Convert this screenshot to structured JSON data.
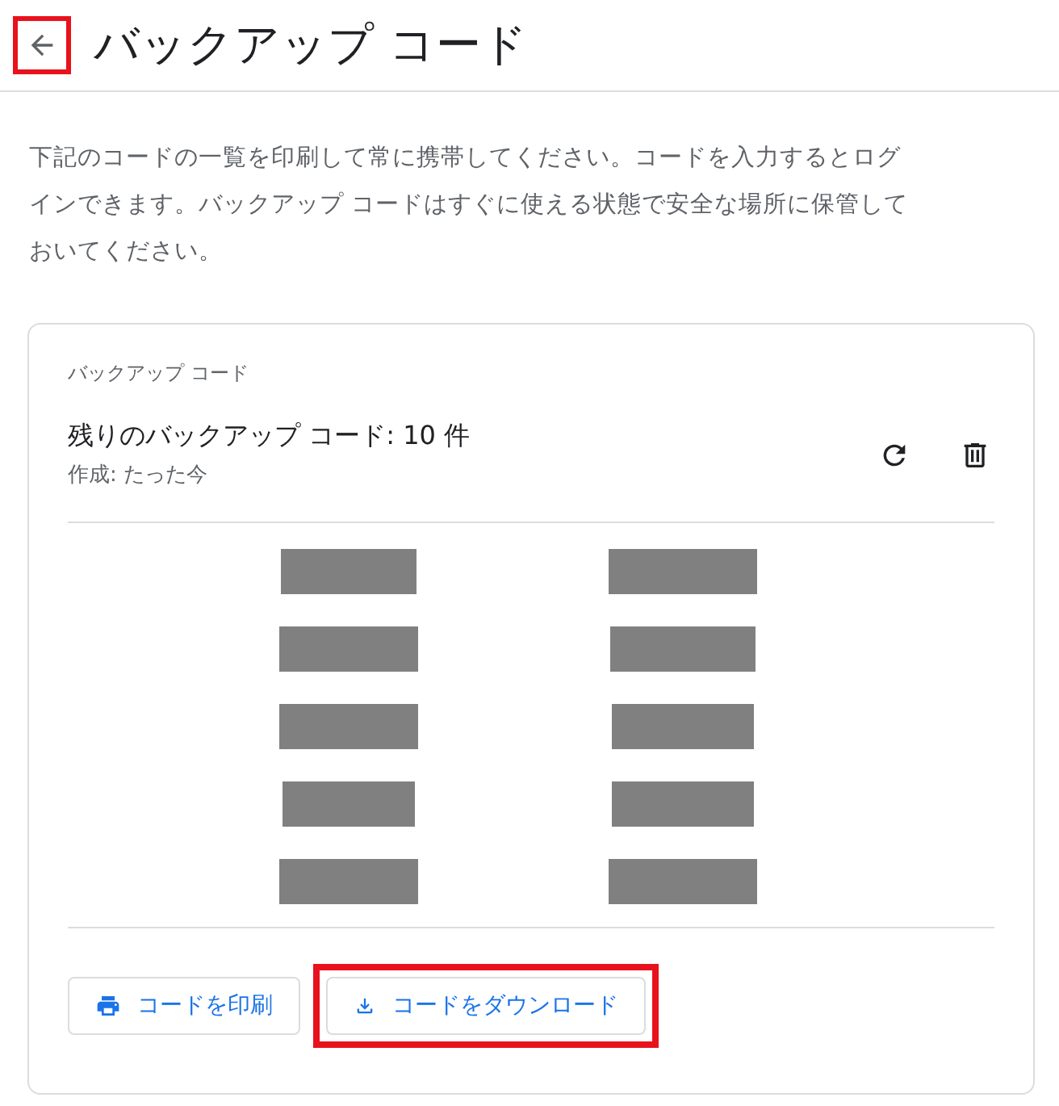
{
  "header": {
    "title": "バックアップ コード",
    "back_button": {
      "highlighted": true
    }
  },
  "description": "下記のコードの一覧を印刷して常に携帯してください。コードを入力するとログインできます。バックアップ コードはすぐに使える状態で安全な場所に保管しておいてください。",
  "card": {
    "label": "バックアップ コード",
    "title": "残りのバックアップ コード: 10 件",
    "subtitle": "作成: たった今",
    "codes": [
      {
        "redacted": true
      },
      {
        "redacted": true
      },
      {
        "redacted": true
      },
      {
        "redacted": true
      },
      {
        "redacted": true
      },
      {
        "redacted": true
      },
      {
        "redacted": true
      },
      {
        "redacted": true
      },
      {
        "redacted": true
      },
      {
        "redacted": true
      }
    ],
    "buttons": [
      {
        "label": "コードを印刷",
        "kind": "print",
        "highlighted": false
      },
      {
        "label": "コードをダウンロード",
        "kind": "download",
        "highlighted": true
      }
    ]
  }
}
